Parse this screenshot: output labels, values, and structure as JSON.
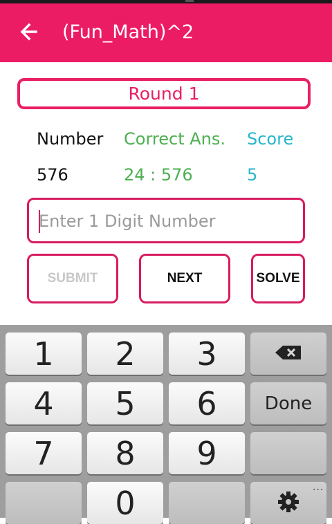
{
  "app": {
    "title": "(Fun_Math)^2"
  },
  "round": {
    "label": "Round 1"
  },
  "stats": {
    "headers": {
      "number": "Number",
      "correct": "Correct Ans.",
      "score": "Score"
    },
    "values": {
      "number": "576",
      "correct": "24 : 576",
      "score": "5"
    }
  },
  "answer_input": {
    "placeholder": "Enter 1 Digit Number",
    "value": ""
  },
  "buttons": {
    "submit": "SUBMIT",
    "next": "NEXT",
    "solve": "SOLVE"
  },
  "keyboard": {
    "keys": [
      "1",
      "2",
      "3",
      "4",
      "5",
      "6",
      "7",
      "8",
      "9",
      "0"
    ],
    "done": "Done",
    "backspace_icon": "backspace-icon",
    "settings_icon": "gear-icon",
    "more_indicator": "..."
  },
  "colors": {
    "accent": "#ec1c64",
    "correct": "#4caf50",
    "score": "#26b6cc"
  }
}
